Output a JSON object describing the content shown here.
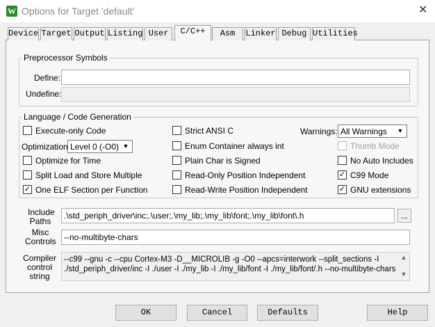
{
  "window": {
    "app_icon": "W",
    "title": "Options for Target 'default'",
    "close_glyph": "✕"
  },
  "tabs": [
    {
      "label": "Device"
    },
    {
      "label": "Target"
    },
    {
      "label": "Output"
    },
    {
      "label": "Listing"
    },
    {
      "label": "User"
    },
    {
      "label": "C/C++",
      "active": true
    },
    {
      "label": "Asm"
    },
    {
      "label": "Linker"
    },
    {
      "label": "Debug"
    },
    {
      "label": "Utilities"
    }
  ],
  "preprocessor": {
    "group_label": "Preprocessor Symbols",
    "define_label": "Define:",
    "define_value": "",
    "undefine_label": "Undefine:",
    "undefine_value": ""
  },
  "language": {
    "group_label": "Language / Code Generation",
    "execute_only": {
      "label": "Execute-only Code",
      "checked": false
    },
    "optimization_label": "Optimization:",
    "optimization_value": "Level 0 (-O0)",
    "optimize_time": {
      "label": "Optimize for Time",
      "checked": false
    },
    "split_load_store": {
      "label": "Split Load and Store Multiple",
      "checked": false
    },
    "one_elf": {
      "label": "One ELF Section per Function",
      "checked": true,
      "mark": "✓"
    },
    "strict_ansi": {
      "label": "Strict ANSI C",
      "checked": false
    },
    "enum_container": {
      "label": "Enum Container always int",
      "checked": false
    },
    "plain_char": {
      "label": "Plain Char is Signed",
      "checked": false
    },
    "ro_pi": {
      "label": "Read-Only Position Independent",
      "checked": false
    },
    "rw_pi": {
      "label": "Read-Write Position Independent",
      "checked": false
    },
    "warnings_label": "Warnings:",
    "warnings_value": "All Warnings",
    "thumb_mode": {
      "label": "Thumb Mode",
      "checked": false,
      "disabled": true
    },
    "no_auto_includes": {
      "label": "No Auto Includes",
      "checked": false
    },
    "c99_mode": {
      "label": "C99 Mode",
      "checked": true,
      "mark": "✓"
    },
    "gnu_extensions": {
      "label": "GNU extensions",
      "checked": true,
      "mark": "✓"
    }
  },
  "include_paths": {
    "label_line1": "Include",
    "label_line2": "Paths",
    "value": ".\\std_periph_driver\\inc;.\\user;.\\my_lib;.\\my_lib\\font;.\\my_lib\\font\\.h",
    "browse_label": "..."
  },
  "misc_controls": {
    "label_line1": "Misc",
    "label_line2": "Controls",
    "value": "--no-multibyte-chars"
  },
  "compiler_string": {
    "label_line1": "Compiler",
    "label_line2": "control",
    "label_line3": "string",
    "line1": "--c99 --gnu -c --cpu Cortex-M3 -D__MICROLIB -g -O0 --apcs=interwork --split_sections -I",
    "line2": "./std_periph_driver/inc -I ./user -I ./my_lib -I ./my_lib/font -I ./my_lib/font/.h --no-multibyte-chars",
    "scroll_up": "▲",
    "scroll_down": "▼"
  },
  "dropdown_arrow": "▼",
  "buttons": {
    "ok": "OK",
    "cancel": "Cancel",
    "defaults": "Defaults",
    "help": "Help"
  }
}
